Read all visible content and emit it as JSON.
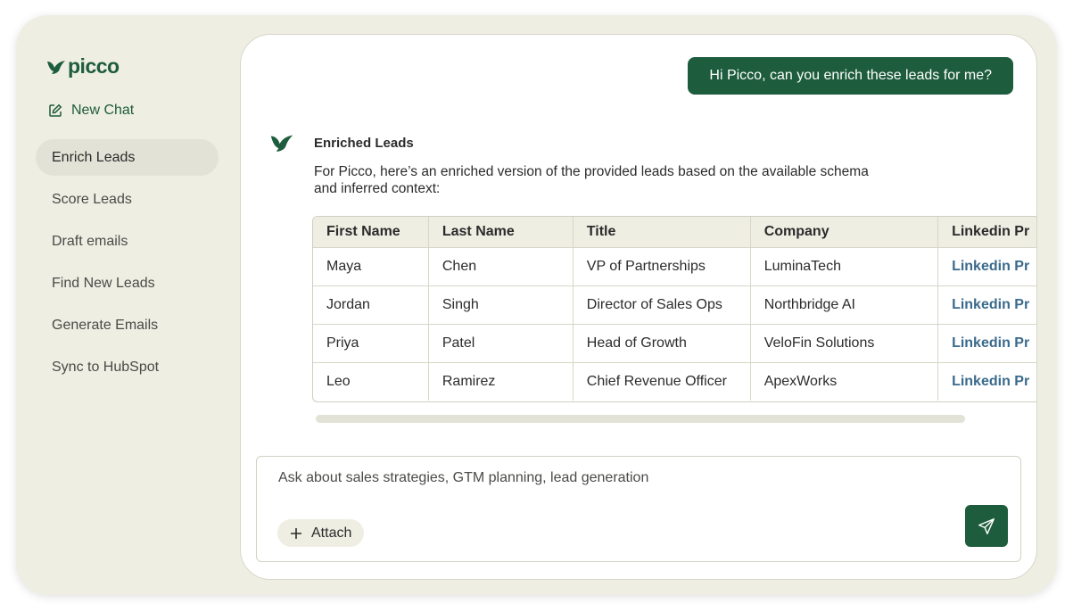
{
  "brand": {
    "name": "picco",
    "logo_icon": "bird-icon",
    "color": "#1d5c3c"
  },
  "sidebar": {
    "new_chat_label": "New Chat",
    "items": [
      {
        "label": "Enrich Leads",
        "active": true
      },
      {
        "label": "Score Leads"
      },
      {
        "label": "Draft emails"
      },
      {
        "label": "Find New Leads"
      },
      {
        "label": "Generate Emails"
      },
      {
        "label": "Sync to HubSpot"
      }
    ]
  },
  "chat": {
    "user_message": "Hi Picco, can you enrich these leads for me?",
    "bot_title": "Enriched Leads",
    "bot_text": "For Picco, here’s an enriched version of the provided leads based on the available schema and inferred context:"
  },
  "table": {
    "headers": [
      "First Name",
      "Last Name",
      "Title",
      "Company",
      "Linkedin Pr"
    ],
    "rows": [
      [
        "Maya",
        "Chen",
        "VP of Partnerships",
        "LuminaTech",
        "Linkedin Pr"
      ],
      [
        "Jordan",
        "Singh",
        "Director of Sales Ops",
        "Northbridge AI",
        "Linkedin Pr"
      ],
      [
        "Priya",
        "Patel",
        "Head of Growth",
        "VeloFin Solutions",
        "Linkedin Pr"
      ],
      [
        "Leo",
        "Ramirez",
        "Chief Revenue Officer",
        "ApexWorks",
        "Linkedin Pr"
      ]
    ]
  },
  "composer": {
    "placeholder": "Ask about sales strategies, GTM planning, lead generation",
    "attach_label": "Attach"
  }
}
